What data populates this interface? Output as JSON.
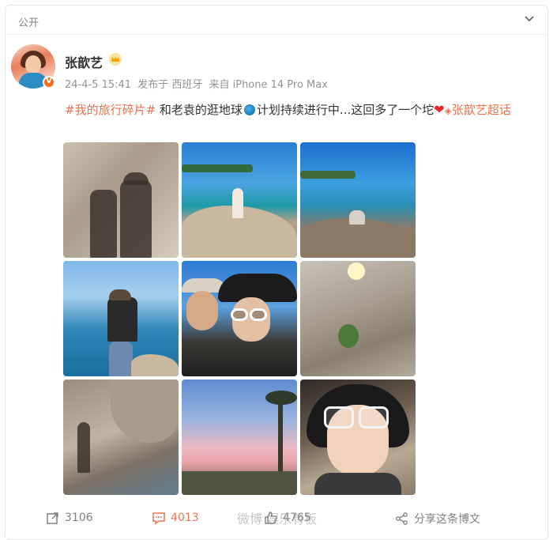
{
  "header": {
    "visibility": "公开",
    "chevron_icon": "chevron-down-icon"
  },
  "post": {
    "author": "张歆艺",
    "author_badge_icon": "vip-crown-icon",
    "verified_icon": "verified-v-icon",
    "date": "24-4-5 15:41",
    "location": "发布于 西班牙",
    "source": "来自 iPhone 14 Pro Max",
    "text": {
      "hashtag": "#我的旅行碎片#",
      "body_part1": " 和老袁的逛地球",
      "body_part2": "计划持续进行中...这回多了一个坨",
      "supertopic": "张歆艺超话"
    },
    "photos": [
      {
        "name": "shadow-couple-photo"
      },
      {
        "name": "child-on-rock-photo"
      },
      {
        "name": "rocky-coast-photo"
      },
      {
        "name": "boy-by-sea-photo"
      },
      {
        "name": "couple-selfie-photo"
      },
      {
        "name": "rocks-closeup-photo"
      },
      {
        "name": "cliff-shadow-photo"
      },
      {
        "name": "pink-sunset-photo"
      },
      {
        "name": "woman-sunglasses-photo"
      }
    ]
  },
  "actions": {
    "repost": "3106",
    "comment": "4013",
    "like": "4765",
    "share": "分享这条博文"
  },
  "watermark": "微博 娱乐有板"
}
